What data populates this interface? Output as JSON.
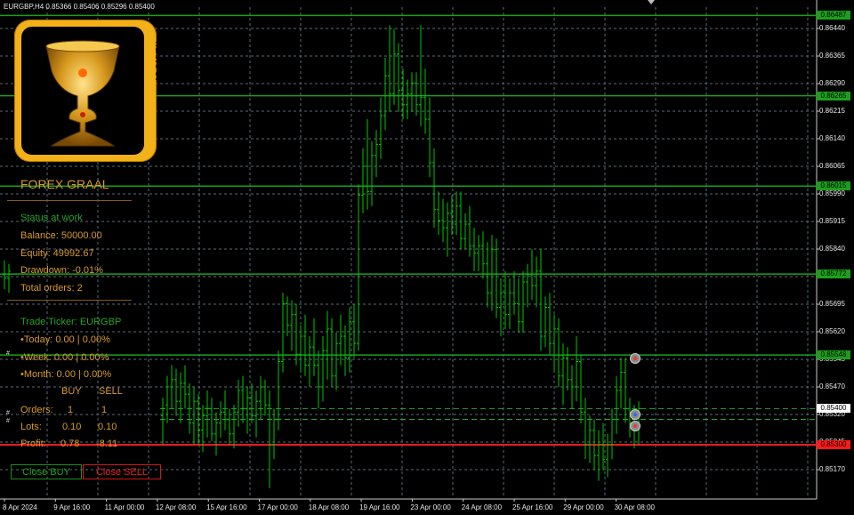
{
  "window": {
    "symbol_info": "EURGBP,H4  0.85366 0.85406 0.85296 0.85400"
  },
  "logo": {
    "text": "AC-CAPITAL"
  },
  "panel": {
    "title": "FOREX GRAAL",
    "status": "Status at work",
    "balance": "Balance: 50000.00",
    "equity": "Equity: 49992.67",
    "drawdown": "Drawdown: -0.01%",
    "total_orders": "Total orders: 2",
    "ticker": "Trade Ticker: EURGBP",
    "today": "•Today: 0.00 | 0.00%",
    "week": "•Week: 0.00 | 0.00%",
    "month": "•Month: 0.00 | 0.00%",
    "col_buy": "BUY",
    "col_sell": "SELL",
    "orders_label": "Orders:",
    "orders_buy": "1",
    "orders_sell": "1",
    "lots_label": "Lots:",
    "lots_buy": "0.10",
    "lots_sell": "0.10",
    "profit_label": "Profit:",
    "profit_buy": "0.78",
    "profit_sell": "-8.11",
    "close_buy": "Close BUY",
    "close_sell": "Close SELL"
  },
  "price_axis": [
    "0.86440",
    "0.86365",
    "0.86290",
    "0.86215",
    "0.86140",
    "0.86065",
    "0.85990",
    "0.85915",
    "0.85840",
    "0.85770",
    "0.85695",
    "0.85620",
    "0.85545",
    "0.85470",
    "0.85320",
    "0.85245",
    "0.85170"
  ],
  "price_tags": [
    {
      "text": "0.86487",
      "type": "green"
    },
    {
      "text": "0.86265",
      "type": "green"
    },
    {
      "text": "0.86015",
      "type": "green"
    },
    {
      "text": "0.85772",
      "type": "green"
    },
    {
      "text": "0.85548",
      "type": "green"
    },
    {
      "text": "0.85400",
      "type": "current"
    },
    {
      "text": "0.85300",
      "type": "red"
    }
  ],
  "time_axis": [
    "8 Apr 2024",
    "9 Apr 16:00",
    "11 Apr 00:00",
    "12 Apr 08:00",
    "15 Apr 16:00",
    "17 Apr 00:00",
    "18 Apr 08:00",
    "19 Apr 16:00",
    "23 Apr 00:00",
    "24 Apr 08:00",
    "25 Apr 16:00",
    "29 Apr 00:00",
    "30 Apr 08:00"
  ],
  "chart_data": {
    "type": "candlestick",
    "symbol": "EURGBP",
    "timeframe": "H4",
    "y_range": [
      0.8515,
      0.8651
    ],
    "levels": [
      0.86487,
      0.86265,
      0.86015,
      0.85772,
      0.85548,
      0.853
    ],
    "open_orders_level": [
      0.854,
      0.8537
    ],
    "bid": 0.854,
    "colors": {
      "bars": "#00c800",
      "grid": "#5a6a78",
      "levels": "#1a9f1a",
      "red_level": "#ff1a1a"
    }
  }
}
